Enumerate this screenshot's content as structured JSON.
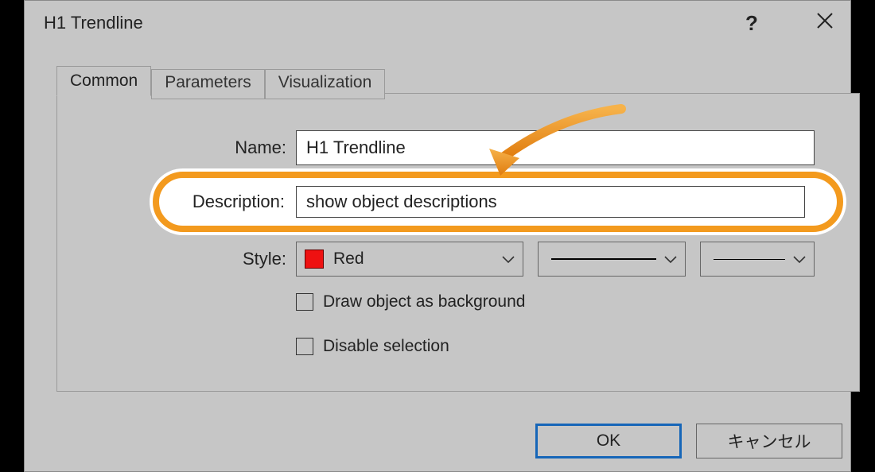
{
  "dialog": {
    "title": "H1 Trendline"
  },
  "tabs": {
    "common": "Common",
    "parameters": "Parameters",
    "visualization": "Visualization"
  },
  "labels": {
    "name": "Name:",
    "description": "Description:",
    "style": "Style:"
  },
  "fields": {
    "name_value": "H1 Trendline",
    "description_value": "show object descriptions",
    "color_name": "Red",
    "color_hex": "#e11"
  },
  "checkboxes": {
    "draw_bg": "Draw object as background",
    "disable_sel": "Disable selection"
  },
  "buttons": {
    "ok": "OK",
    "cancel": "キャンセル"
  }
}
